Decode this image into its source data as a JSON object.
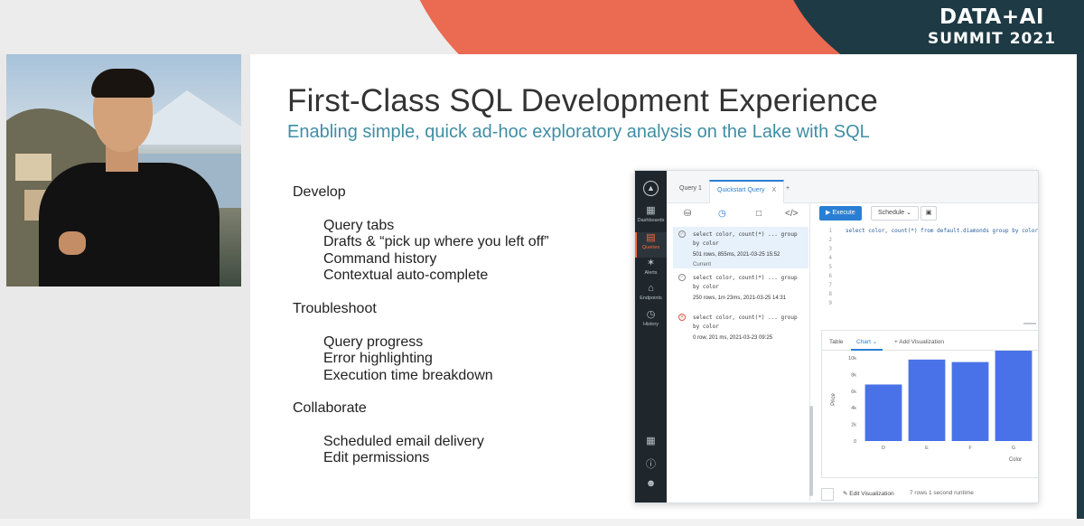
{
  "logo": {
    "line1": "DATA+AI",
    "line2": "SUMMIT 2021"
  },
  "slide": {
    "title": "First-Class SQL Development Experience",
    "subtitle": "Enabling simple, quick ad-hoc exploratory analysis on the Lake with SQL",
    "sections": [
      {
        "heading": "Develop",
        "items": [
          "Query tabs",
          "Drafts & “pick up where you left off”",
          "Command history",
          "Contextual auto-complete"
        ]
      },
      {
        "heading": "Troubleshoot",
        "items": [
          "Query progress",
          "Error highlighting",
          "Execution time breakdown"
        ]
      },
      {
        "heading": "Collaborate",
        "items": [
          "Scheduled email delivery",
          "Edit permissions"
        ]
      }
    ]
  },
  "app": {
    "nav": [
      {
        "label": "Dashboards",
        "icon": "dashboard-icon",
        "glyph": "▦"
      },
      {
        "label": "Queries",
        "icon": "queries-icon",
        "glyph": "▤"
      },
      {
        "label": "Alerts",
        "icon": "alerts-icon",
        "glyph": "✶"
      },
      {
        "label": "Endpoints",
        "icon": "endpoints-icon",
        "glyph": "⌂"
      },
      {
        "label": "History",
        "icon": "history-icon",
        "glyph": "◷"
      }
    ],
    "tabs": [
      "Query 1",
      "Quickstart Query",
      "+"
    ],
    "tab_close": "X",
    "history": [
      {
        "code1": "select color, count(*) ... group",
        "code2": "by color",
        "meta": "501 rows, 855ms,  2021-03-25 15:52",
        "status": "Current"
      },
      {
        "code1": "select color, count(*) ... group",
        "code2": "by color",
        "meta": "250 rows, 1m 23ms, 2021-03-25 14:31",
        "status": ""
      },
      {
        "code1": "select color, count(*) ... group",
        "code2": "by color",
        "meta": "0 row, 201 ms, 2021-03-23 09:25",
        "status": ""
      }
    ],
    "toolbar": {
      "execute": "Execute",
      "schedule": "Schedule ⌄"
    },
    "editor": {
      "line_numbers": "1\n2\n3\n4\n5\n6\n7\n8\n9",
      "code": "select color, count(*) from default.diamonds group by color"
    },
    "viz_tabs": {
      "table": "Table",
      "chart": "Chart ⌄",
      "add": "+ Add Visualization"
    },
    "footer": {
      "edit": "Edit Visualization",
      "runtime": "7 rows 1 second runtime"
    }
  },
  "chart_data": {
    "type": "bar",
    "categories": [
      "D",
      "E",
      "F",
      "G"
    ],
    "values": [
      6800,
      9800,
      9500,
      11300
    ],
    "xlabel": "Color",
    "ylabel": "Price",
    "yticks": [
      "0",
      "2k",
      "4k",
      "6k",
      "8k",
      "10k"
    ],
    "ylim": [
      0,
      10000
    ],
    "color": "#4a72e8"
  },
  "colors": {
    "accent": "#3f8ea4",
    "brand_orange": "#ea6a52",
    "nav_dark": "#1f272d",
    "primary_blue": "#2a7fd4"
  }
}
